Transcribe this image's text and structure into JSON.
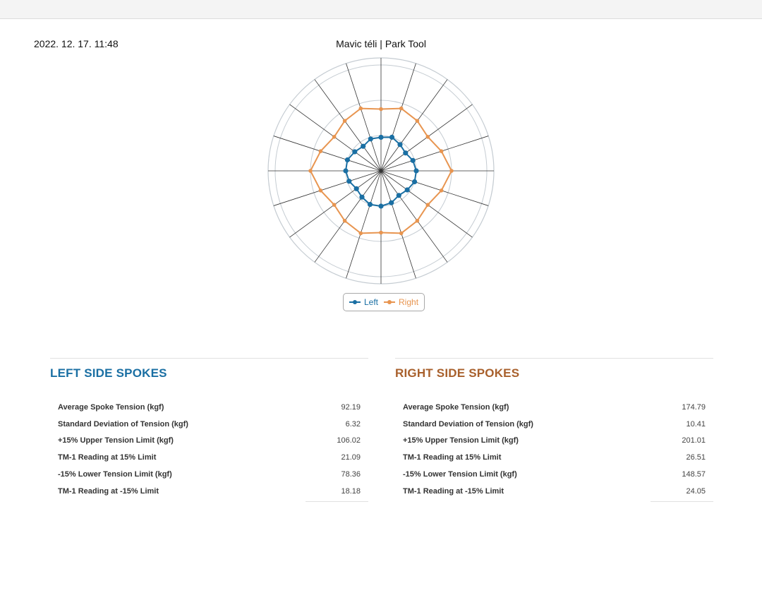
{
  "header": {
    "timestamp": "2022. 12. 17. 11:48",
    "title": "Mavic téli | Park Tool"
  },
  "colors": {
    "left": "#1a6fa3",
    "right": "#e89550",
    "left_heading": "#1a6fa3",
    "right_heading": "#a8602c",
    "spoke_line": "#333333",
    "ring": "#c5ccd2"
  },
  "chart_data": {
    "type": "radar",
    "axis_count": 20,
    "rmax": 320,
    "rings": [
      100,
      200,
      300
    ],
    "grid": true,
    "legend_position": "bottom",
    "series": [
      {
        "name": "Left",
        "values": [
          95,
          100,
          92,
          86,
          95,
          100,
          100,
          92,
          86,
          95,
          100,
          100,
          92,
          86,
          95,
          100,
          100,
          92,
          86,
          95
        ]
      },
      {
        "name": "Right",
        "values": [
          175,
          186,
          175,
          164,
          180,
          200,
          180,
          164,
          175,
          186,
          175,
          186,
          175,
          164,
          180,
          200,
          180,
          164,
          175,
          186
        ]
      }
    ]
  },
  "left": {
    "title": "LEFT SIDE SPOKES",
    "rows": [
      {
        "label": "Average Spoke Tension (kgf)",
        "value": "92.19"
      },
      {
        "label": "Standard Deviation of Tension (kgf)",
        "value": "6.32"
      },
      {
        "label": "+15% Upper Tension Limit (kgf)",
        "value": "106.02"
      },
      {
        "label": "TM-1 Reading at 15% Limit",
        "value": "21.09"
      },
      {
        "label": "-15% Lower Tension Limit (kgf)",
        "value": "78.36"
      },
      {
        "label": "TM-1 Reading at -15% Limit",
        "value": "18.18"
      }
    ]
  },
  "right": {
    "title": "RIGHT SIDE SPOKES",
    "rows": [
      {
        "label": "Average Spoke Tension (kgf)",
        "value": "174.79"
      },
      {
        "label": "Standard Deviation of Tension (kgf)",
        "value": "10.41"
      },
      {
        "label": "+15% Upper Tension Limit (kgf)",
        "value": "201.01"
      },
      {
        "label": "TM-1 Reading at 15% Limit",
        "value": "26.51"
      },
      {
        "label": "-15% Lower Tension Limit (kgf)",
        "value": "148.57"
      },
      {
        "label": "TM-1 Reading at -15% Limit",
        "value": "24.05"
      }
    ]
  }
}
